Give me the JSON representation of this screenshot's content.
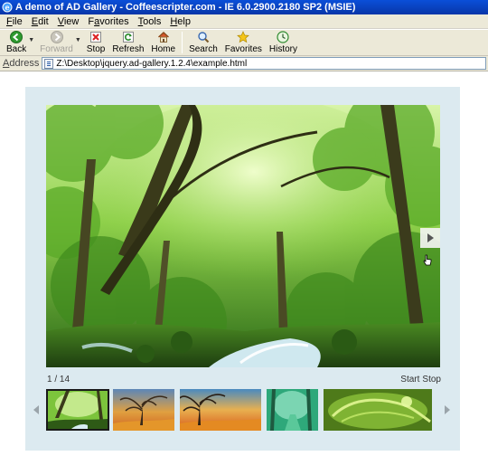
{
  "window": {
    "title": "A demo of AD Gallery - Coffeescripter.com - IE 6.0.2900.2180 SP2 (MSIE)"
  },
  "menu": [
    {
      "pre": "",
      "ul": "F",
      "post": "ile"
    },
    {
      "pre": "",
      "ul": "E",
      "post": "dit"
    },
    {
      "pre": "",
      "ul": "V",
      "post": "iew"
    },
    {
      "pre": "F",
      "ul": "a",
      "post": "vorites"
    },
    {
      "pre": "",
      "ul": "T",
      "post": "ools"
    },
    {
      "pre": "",
      "ul": "H",
      "post": "elp"
    }
  ],
  "toolbar": {
    "back": "Back",
    "forward": "Forward",
    "stop": "Stop",
    "refresh": "Refresh",
    "home": "Home",
    "search": "Search",
    "favorites": "Favorites",
    "history": "History"
  },
  "address": {
    "label_ul": "A",
    "label_rest": "ddress",
    "url": "Z:\\Desktop\\jquery.ad-gallery.1.2.4\\example.html"
  },
  "gallery": {
    "counter": "1 / 14",
    "start": "Start",
    "stop": "Stop"
  },
  "colors": {
    "titlebar": "#0a4fd8",
    "chrome": "#ece9d8",
    "gallery_bg": "#dceaf0"
  }
}
